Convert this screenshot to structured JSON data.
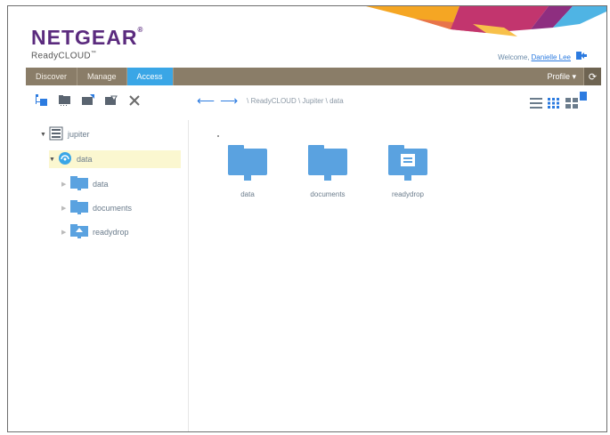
{
  "header": {
    "logo_text": "NETGEAR",
    "logo_tm": "®",
    "product_name": "ReadyCLOUD",
    "product_tm": "™",
    "welcome_prefix": "Welcome,",
    "user_name": "Danielle Lee"
  },
  "nav": {
    "tabs": [
      {
        "label": "Discover",
        "active": false
      },
      {
        "label": "Manage",
        "active": false
      },
      {
        "label": "Access",
        "active": true
      }
    ],
    "profile_label": "Profile ▾",
    "refresh_icon": "refresh-icon"
  },
  "toolbar": {
    "icons": [
      "new-folder-icon",
      "folder-icon",
      "upload-icon",
      "download-icon",
      "delete-icon"
    ],
    "breadcrumb": "\\ ReadyCLOUD \\ Jupiter \\ data"
  },
  "view_modes": [
    "list-view-icon",
    "grid-view-icon",
    "tile-view-icon"
  ],
  "tree": {
    "root": {
      "label": "jupiter"
    },
    "volume": {
      "label": "data"
    },
    "children": [
      {
        "label": "data",
        "icon": "shared-folder-icon"
      },
      {
        "label": "documents",
        "icon": "shared-folder-icon"
      },
      {
        "label": "readydrop",
        "icon": "readydrop-folder-icon"
      }
    ]
  },
  "content": {
    "items": [
      {
        "label": "data",
        "icon": "shared-folder-icon"
      },
      {
        "label": "documents",
        "icon": "shared-folder-icon"
      },
      {
        "label": "readydrop",
        "icon": "readydrop-folder-icon"
      }
    ]
  },
  "colors": {
    "brand_purple": "#5b2b7e",
    "nav_bg": "#8a7d68",
    "active_tab": "#3aa6e6",
    "folder_blue": "#5aa2e0",
    "selection": "#fbf7d0"
  }
}
